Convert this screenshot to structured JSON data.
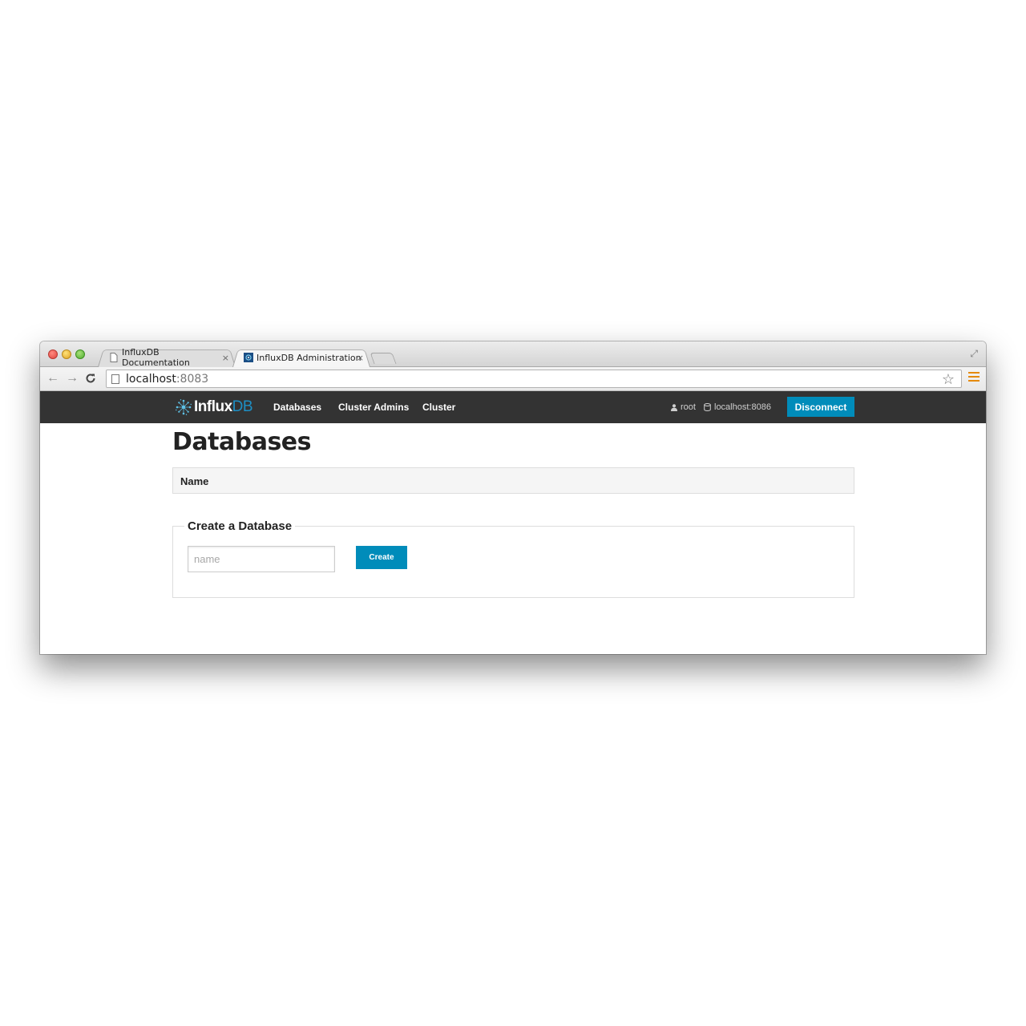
{
  "browser": {
    "tabs": [
      {
        "title": "InfluxDB Documentation",
        "active": false
      },
      {
        "title": "InfluxDB Administration",
        "active": true
      }
    ],
    "close_glyph": "×",
    "url_host": "localhost",
    "url_port": ":8083"
  },
  "navbar": {
    "brand_primary": "Influx",
    "brand_secondary": "DB",
    "links": [
      "Databases",
      "Cluster Admins",
      "Cluster"
    ],
    "user": "root",
    "host": "localhost:8086",
    "disconnect_label": "Disconnect",
    "background": "#333333",
    "accent": "#008cba"
  },
  "main": {
    "title": "Databases",
    "table_header": "Name",
    "create_section": {
      "legend": "Create a Database",
      "input_placeholder": "name",
      "input_value": "",
      "button_label": "Create"
    }
  }
}
